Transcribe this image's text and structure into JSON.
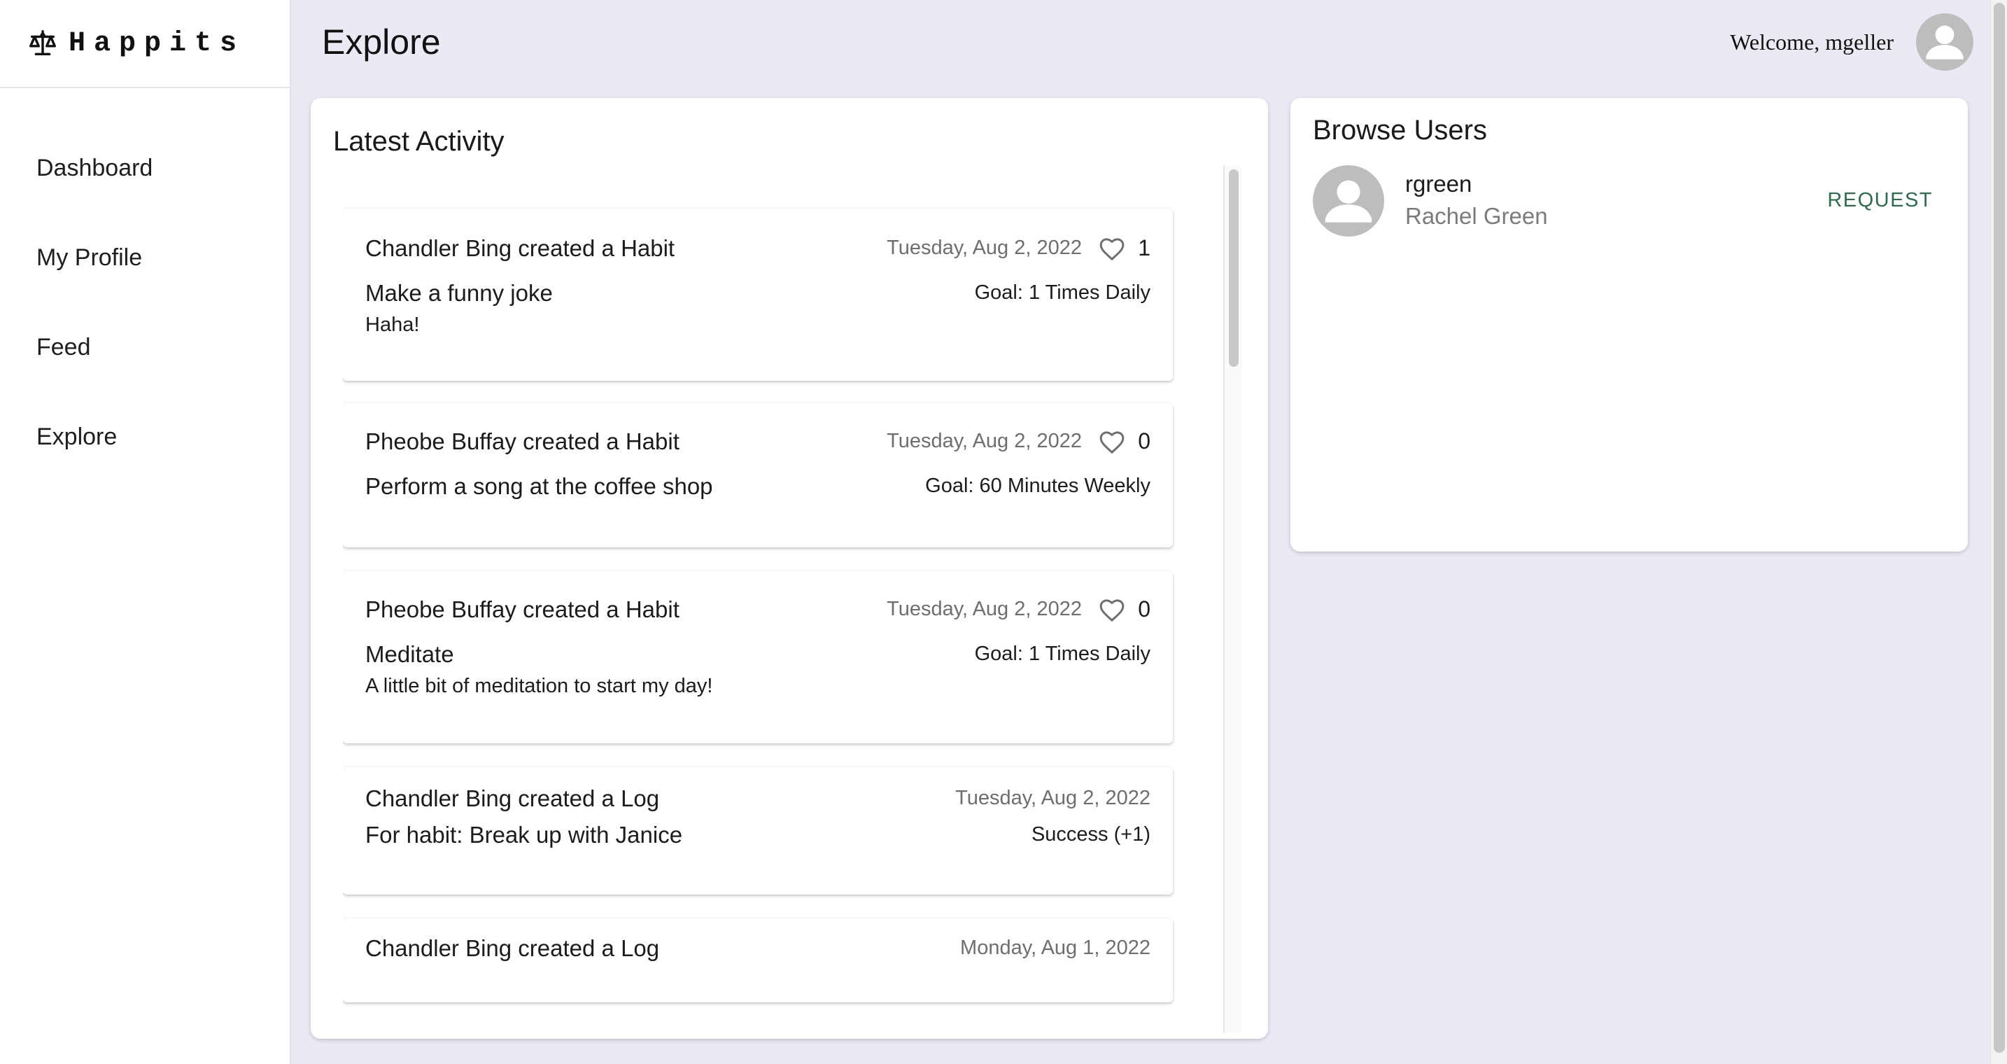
{
  "brand": {
    "name": "Happits",
    "icon": "scale-icon"
  },
  "sidebar": {
    "items": [
      {
        "label": "Dashboard"
      },
      {
        "label": "My Profile"
      },
      {
        "label": "Feed"
      },
      {
        "label": "Explore"
      }
    ]
  },
  "header": {
    "title": "Explore",
    "welcome": "Welcome, mgeller"
  },
  "activity": {
    "title": "Latest Activity",
    "items": [
      {
        "headline": "Chandler Bing created a Habit",
        "date": "Tuesday, Aug 2, 2022",
        "likes": "1",
        "title": "Make a funny joke",
        "goal": "Goal: 1 Times Daily",
        "desc": "Haha!"
      },
      {
        "headline": "Pheobe Buffay created a Habit",
        "date": "Tuesday, Aug 2, 2022",
        "likes": "0",
        "title": "Perform a song at the coffee shop",
        "goal": "Goal: 60 Minutes Weekly",
        "desc": ""
      },
      {
        "headline": "Pheobe Buffay created a Habit",
        "date": "Tuesday, Aug 2, 2022",
        "likes": "0",
        "title": "Meditate",
        "goal": "Goal: 1 Times Daily",
        "desc": "A little bit of meditation to start my day!"
      },
      {
        "headline": "Chandler Bing created a Log",
        "date": "Tuesday, Aug 2, 2022",
        "title": "For habit: Break up with Janice",
        "goal": "Success (+1)"
      },
      {
        "headline": "Chandler Bing created a Log",
        "date": "Monday, Aug 1, 2022"
      }
    ]
  },
  "users": {
    "title": "Browse Users",
    "items": [
      {
        "username": "rgreen",
        "fullname": "Rachel Green",
        "action": "REQUEST"
      }
    ]
  },
  "colors": {
    "background": "#ebe9f4",
    "accent": "#2f6b4f",
    "muted": "#6e6e6e"
  }
}
